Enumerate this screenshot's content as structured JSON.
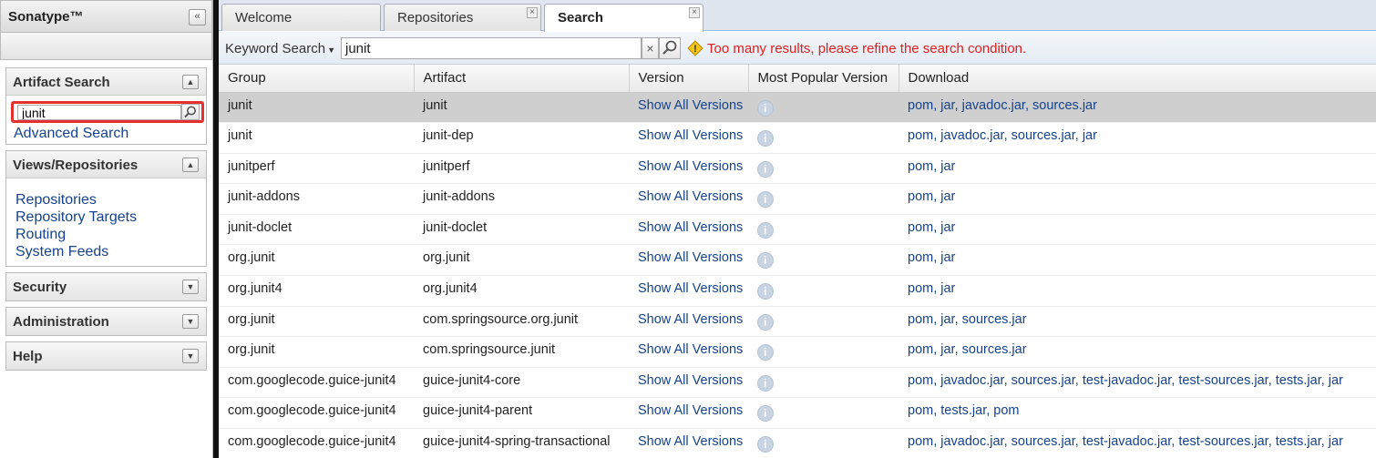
{
  "sidebar": {
    "title": "Sonatype™",
    "collapse_glyph": "«",
    "artifact_search": {
      "title": "Artifact Search",
      "search_value": "junit",
      "advanced_link": "Advanced Search"
    },
    "views": {
      "title": "Views/Repositories",
      "links": [
        "Repositories",
        "Repository Targets",
        "Routing",
        "System Feeds"
      ]
    },
    "sections": [
      "Security",
      "Administration",
      "Help"
    ]
  },
  "tabs": [
    {
      "label": "Welcome",
      "closable": false,
      "active": false
    },
    {
      "label": "Repositories",
      "closable": true,
      "active": false
    },
    {
      "label": "Search",
      "closable": true,
      "active": true
    }
  ],
  "toolbar": {
    "search_mode": "Keyword Search",
    "query": "junit",
    "warning": "Too many results, please refine the search condition."
  },
  "grid": {
    "columns": [
      "Group",
      "Artifact",
      "Version",
      "Most Popular Version",
      "Download"
    ],
    "rows": [
      {
        "group": "junit",
        "artifact": "junit",
        "version": "Show All Versions",
        "download": "pom, jar, javadoc.jar, sources.jar",
        "selected": true
      },
      {
        "group": "junit",
        "artifact": "junit-dep",
        "version": "Show All Versions",
        "download": "pom, javadoc.jar, sources.jar, jar"
      },
      {
        "group": "junitperf",
        "artifact": "junitperf",
        "version": "Show All Versions",
        "download": "pom, jar"
      },
      {
        "group": "junit-addons",
        "artifact": "junit-addons",
        "version": "Show All Versions",
        "download": "pom, jar"
      },
      {
        "group": "junit-doclet",
        "artifact": "junit-doclet",
        "version": "Show All Versions",
        "download": "pom, jar"
      },
      {
        "group": "org.junit",
        "artifact": "org.junit",
        "version": "Show All Versions",
        "download": "pom, jar"
      },
      {
        "group": "org.junit4",
        "artifact": "org.junit4",
        "version": "Show All Versions",
        "download": "pom, jar"
      },
      {
        "group": "org.junit",
        "artifact": "com.springsource.org.junit",
        "version": "Show All Versions",
        "download": "pom, jar, sources.jar"
      },
      {
        "group": "org.junit",
        "artifact": "com.springsource.junit",
        "version": "Show All Versions",
        "download": "pom, jar, sources.jar"
      },
      {
        "group": "com.googlecode.guice-junit4",
        "artifact": "guice-junit4-core",
        "version": "Show All Versions",
        "download": "pom, javadoc.jar, sources.jar, test-javadoc.jar, test-sources.jar, tests.jar, jar"
      },
      {
        "group": "com.googlecode.guice-junit4",
        "artifact": "guice-junit4-parent",
        "version": "Show All Versions",
        "download": "pom, tests.jar, pom"
      },
      {
        "group": "com.googlecode.guice-junit4",
        "artifact": "guice-junit4-spring-transactional",
        "version": "Show All Versions",
        "download": "pom, javadoc.jar, sources.jar, test-javadoc.jar, test-sources.jar, tests.jar, jar"
      }
    ]
  },
  "colors": {
    "link": "#15428b",
    "warning": "#e02020",
    "highlight_border": "#e53030",
    "selected_row": "#cfcfcf"
  }
}
